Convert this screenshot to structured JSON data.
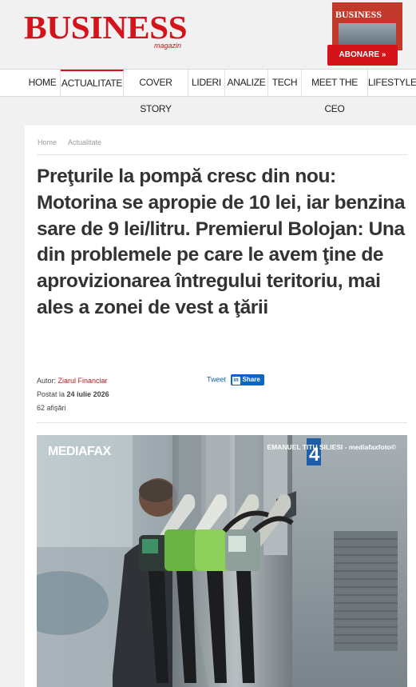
{
  "header": {
    "logo_text": "BUSINESS",
    "logo_sub": "magazin",
    "promo_mag_title": "BUSINESS",
    "subscribe_label": "ABONARE »"
  },
  "nav": {
    "items": [
      "HOME",
      "ACTUALITATE",
      "COVER STORY",
      "LIDERI",
      "ANALIZE",
      "TECH",
      "MEET THE CEO",
      "LIFESTYLE"
    ],
    "active": "ACTUALITATE"
  },
  "article": {
    "breadcrumb": [
      "Home",
      "Actualitate"
    ],
    "title": "Preţurile la pompă cresc din nou: Motorina se apropie de 10 lei, iar benzina sare de 9 lei/litru. Premierul Bolojan: Una din problemele pe care le avem ţine de aprovizionarea întregului teritoriu, mai ales a zonei de vest a ţării",
    "author_label": "Autor:",
    "author": "Ziarul Financiar",
    "posted_label": "Postat la",
    "posted_date": "24 iulie 2026",
    "views": "62 afişări",
    "tweet_label": "Tweet",
    "share_label": "Share",
    "image_watermark": "MEDIAFAX",
    "image_credit": "EMANUEL TITU SILIESI - mediafaxfoto©",
    "pump_number": "4"
  },
  "colors": {
    "brand_red": "#d4131b",
    "linkedin_blue": "#0a66c2",
    "title_text": "#333333"
  }
}
